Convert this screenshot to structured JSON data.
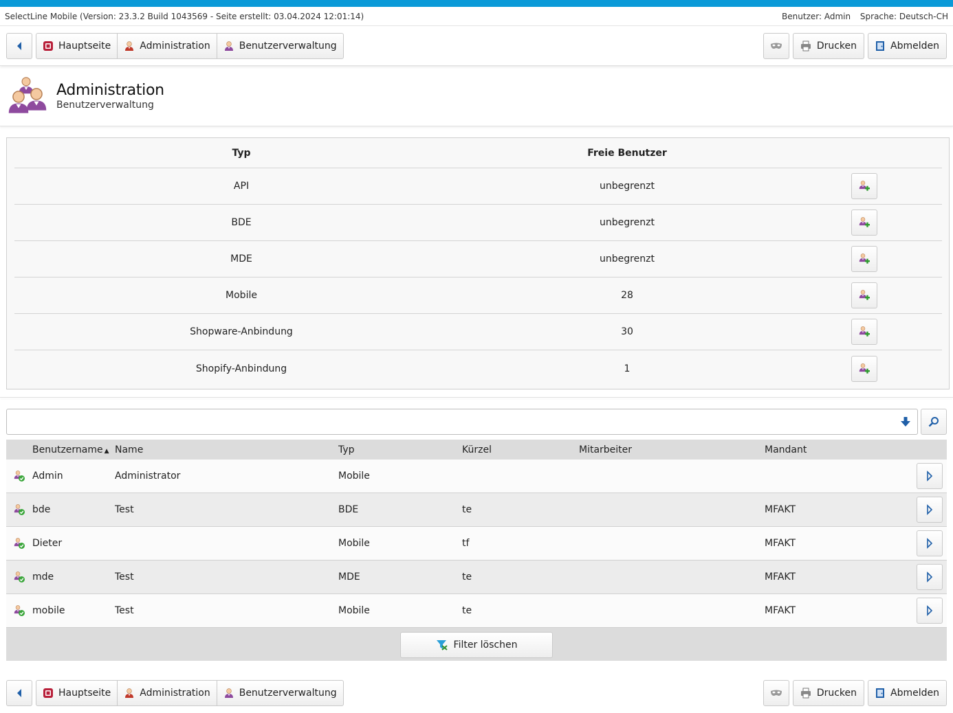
{
  "app_info": {
    "version_text": "SelectLine Mobile (Version: 23.3.2 Build 1043569 - Seite erstellt: 03.04.2024 12:01:14)",
    "user_text": "Benutzer: Admin",
    "language_text": "Sprache: Deutsch-CH"
  },
  "nav": {
    "breadcrumbs": [
      "Hauptseite",
      "Administration",
      "Benutzerverwaltung"
    ],
    "print_label": "Drucken",
    "logout_label": "Abmelden"
  },
  "header": {
    "title": "Administration",
    "subtitle": "Benutzerverwaltung"
  },
  "license_table": {
    "headers": {
      "typ": "Typ",
      "frei": "Freie Benutzer"
    },
    "rows": [
      {
        "typ": "API",
        "frei": "unbegrenzt"
      },
      {
        "typ": "BDE",
        "frei": "unbegrenzt"
      },
      {
        "typ": "MDE",
        "frei": "unbegrenzt"
      },
      {
        "typ": "Mobile",
        "frei": "28"
      },
      {
        "typ": "Shopware-Anbindung",
        "frei": "30"
      },
      {
        "typ": "Shopify-Anbindung",
        "frei": "1"
      }
    ]
  },
  "search": {
    "value": "",
    "placeholder": ""
  },
  "user_table": {
    "headers": {
      "benutzername": "Benutzername",
      "name": "Name",
      "typ": "Typ",
      "kuerzel": "Kürzel",
      "mitarbeiter": "Mitarbeiter",
      "mandant": "Mandant"
    },
    "rows": [
      {
        "benutzername": "Admin",
        "name": "Administrator",
        "typ": "Mobile",
        "kuerzel": "",
        "mitarbeiter": "",
        "mandant": ""
      },
      {
        "benutzername": "bde",
        "name": "Test",
        "typ": "BDE",
        "kuerzel": "te",
        "mitarbeiter": "",
        "mandant": "MFAKT"
      },
      {
        "benutzername": "Dieter",
        "name": "",
        "typ": "Mobile",
        "kuerzel": "tf",
        "mitarbeiter": "",
        "mandant": "MFAKT"
      },
      {
        "benutzername": "mde",
        "name": "Test",
        "typ": "MDE",
        "kuerzel": "te",
        "mitarbeiter": "",
        "mandant": "MFAKT"
      },
      {
        "benutzername": "mobile",
        "name": "Test",
        "typ": "Mobile",
        "kuerzel": "te",
        "mitarbeiter": "",
        "mandant": "MFAKT"
      }
    ],
    "filter_clear_label": "Filter löschen"
  },
  "colors": {
    "accent": "#0a9ad8",
    "user_icon_purple": "#8e4a9e",
    "admin_icon_red": "#c0392b",
    "ok_green": "#3aa63a"
  }
}
